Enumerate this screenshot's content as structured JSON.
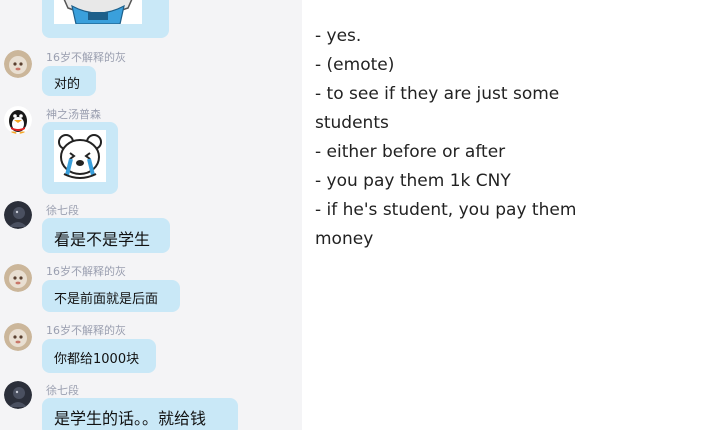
{
  "chat": {
    "messages": [
      {
        "sender": "",
        "avatar": "avatar-brown",
        "type": "sticker",
        "sticker": "cartoon-blue-shirt-sticker"
      },
      {
        "sender": "16岁不解释的灰",
        "avatar": "avatar-brown",
        "type": "text",
        "text": "对的"
      },
      {
        "sender": "神之汤普森",
        "avatar": "qq-penguin-avatar",
        "type": "sticker",
        "sticker": "crying-panda-sticker"
      },
      {
        "sender": "徐七段",
        "avatar": "avatar-dark",
        "type": "text",
        "text": "看是不是学生"
      },
      {
        "sender": "16岁不解释的灰",
        "avatar": "avatar-brown",
        "type": "text",
        "text": "不是前面就是后面"
      },
      {
        "sender": "16岁不解释的灰",
        "avatar": "avatar-brown",
        "type": "text",
        "text": "你都给1000块"
      },
      {
        "sender": "徐七段",
        "avatar": "avatar-dark",
        "type": "text",
        "text": "是学生的话。。就给钱"
      }
    ],
    "colors": {
      "pane_background": "#f4f4f6",
      "bubble": "#c9e8f7",
      "sender_name": "#9a9fb0"
    }
  },
  "translation": {
    "lines": [
      "- yes.",
      "- (emote)",
      "- to see if they are just some",
      "students",
      "- either before or after",
      "- you pay them 1k CNY",
      "- if he's student, you pay them",
      "money"
    ]
  }
}
